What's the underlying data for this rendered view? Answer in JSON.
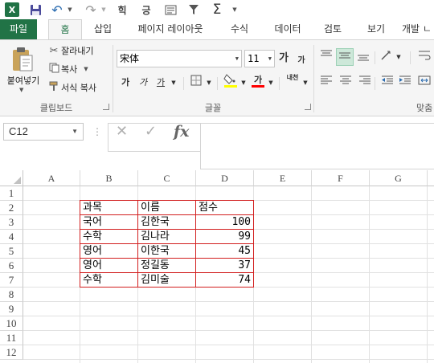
{
  "quick_access": {
    "app_logo": "X",
    "icons": [
      "excel-logo",
      "save-icon",
      "undo-icon",
      "redo-icon",
      "sort-ascending-icon",
      "sort-descending-icon",
      "form-icon",
      "filter-icon",
      "autosum-icon"
    ],
    "sort_a_label": "힉",
    "sort_b_label": "긍"
  },
  "ribbon_tabs": [
    "파일",
    "홈",
    "삽입",
    "페이지 레이아웃",
    "수식",
    "데이터",
    "검토",
    "보기",
    "개발 ㄴ"
  ],
  "active_tab": "홈",
  "clipboard": {
    "paste_label": "붙여넣기",
    "cut_label": "잘라내기",
    "copy_label": "복사",
    "format_painter_label": "서식 복사",
    "group_label": "클립보드"
  },
  "font": {
    "font_name": "宋体",
    "font_size": "11",
    "increase_label": "가",
    "decrease_label": "가",
    "bold_label": "가",
    "italic_label": "가",
    "underline_label": "가",
    "font_color_label": "가",
    "phonetic_label": "내천",
    "group_label": "글꼴",
    "fill_color": "#ffff00",
    "text_color": "#ff0000"
  },
  "alignment": {
    "group_label": "맞춤"
  },
  "formula_bar": {
    "name_box": "C12",
    "fx_label": "fx",
    "value": ""
  },
  "grid": {
    "columns": [
      "A",
      "B",
      "C",
      "D",
      "E",
      "F",
      "G"
    ],
    "rows": [
      "1",
      "2",
      "3",
      "4",
      "5",
      "6",
      "7",
      "8",
      "9",
      "10",
      "11",
      "12"
    ],
    "table": {
      "headers": [
        "과목",
        "이름",
        "점수"
      ],
      "rows": [
        [
          "국어",
          "김한국",
          "100"
        ],
        [
          "수학",
          "김나라",
          "99"
        ],
        [
          "영어",
          "이한국",
          "45"
        ],
        [
          "영어",
          "정길동",
          "37"
        ],
        [
          "수학",
          "김미술",
          "74"
        ]
      ]
    },
    "border_color": "#d21e1e"
  },
  "theme": {
    "accent": "#217346"
  }
}
